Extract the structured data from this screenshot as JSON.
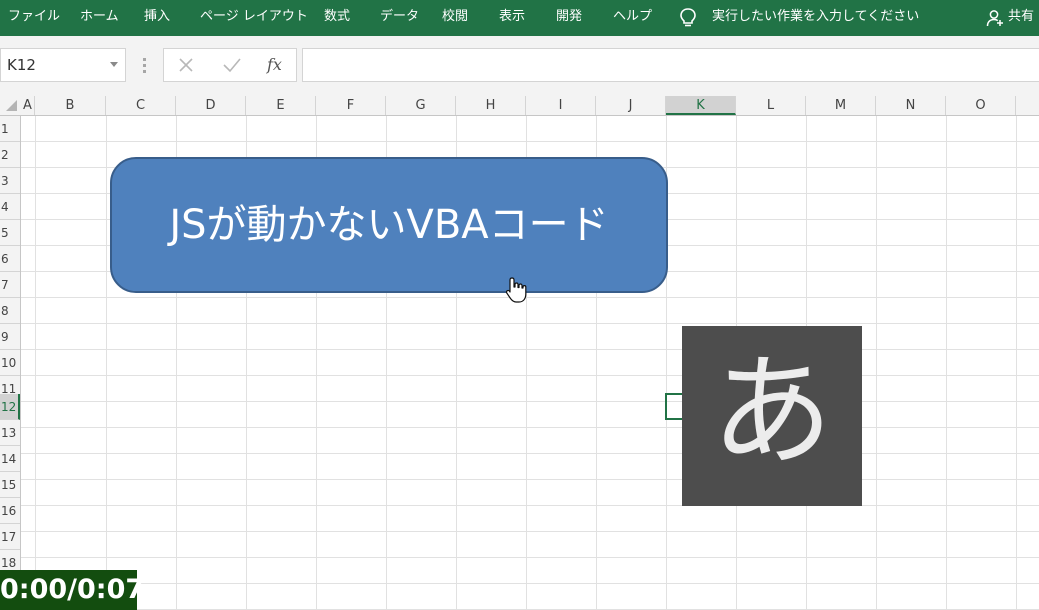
{
  "ribbon": {
    "tabs": [
      "ファイル",
      "ホーム",
      "挿入",
      "ページ レイアウト",
      "数式",
      "データ",
      "校閲",
      "表示",
      "開発",
      "ヘルプ"
    ],
    "tell_me": "実行したい作業を入力してください",
    "share": "共有",
    "color": "#217346"
  },
  "formula_bar": {
    "name_box": "K12",
    "cancel_icon": "cancel-icon",
    "enter_icon": "checkmark-icon",
    "function_label": "fx",
    "formula": ""
  },
  "sheet": {
    "columns": [
      "A",
      "B",
      "C",
      "D",
      "E",
      "F",
      "G",
      "H",
      "I",
      "J",
      "K",
      "L",
      "M",
      "N",
      "O"
    ],
    "rows": [
      "1",
      "2",
      "3",
      "4",
      "5",
      "6",
      "7",
      "8",
      "9",
      "10",
      "11",
      "12",
      "13",
      "14",
      "15",
      "16",
      "17",
      "18"
    ],
    "active_column": "K",
    "active_row": "12",
    "selected_cell": "K12"
  },
  "shape_button": {
    "label": "JSが動かないVBAコード",
    "fill": "#4f81bd"
  },
  "image_box": {
    "character": "あ",
    "fill": "#4d4d4d"
  },
  "video_timer": "0:00/0:07"
}
